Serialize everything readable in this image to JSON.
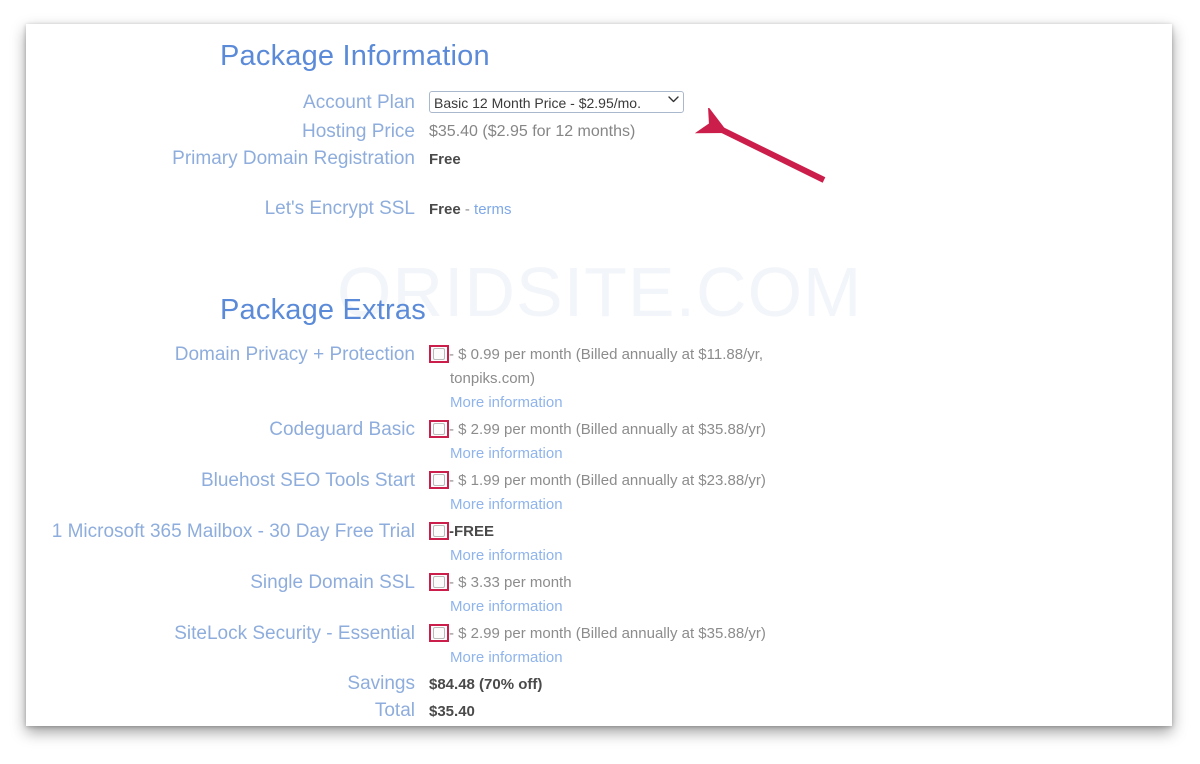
{
  "watermark": "ORIDSITE.COM",
  "sections": {
    "package_information": {
      "title": "Package Information",
      "rows": [
        {
          "label": "Account Plan",
          "type": "select",
          "value": "Basic 12 Month Price - $2.95/mo.",
          "options": [
            "Basic 12 Month Price - $2.95/mo."
          ]
        },
        {
          "label": "Hosting Price",
          "type": "text",
          "value": "$35.40  ($2.95 for 12 months)"
        },
        {
          "label": "Primary Domain Registration",
          "type": "bold",
          "value": "Free"
        },
        {
          "label": "Let's Encrypt SSL",
          "type": "bold_with_link",
          "value": "Free",
          "separator": " - ",
          "link_text": "terms"
        }
      ]
    },
    "package_extras": {
      "title": "Package Extras",
      "more_information_label": "More information",
      "rows": [
        {
          "label": "Domain Privacy + Protection",
          "type": "checkbox",
          "checked": false,
          "price_text": "- $ 0.99 per month (Billed annually at $11.88/yr,",
          "price_cont": "tonpiks.com)",
          "more_link": "More information"
        },
        {
          "label": "Codeguard Basic",
          "type": "checkbox",
          "checked": false,
          "price_text": "- $ 2.99 per month (Billed annually at $35.88/yr)",
          "price_cont": "",
          "more_link": "More information"
        },
        {
          "label": "Bluehost SEO Tools Start",
          "type": "checkbox",
          "checked": false,
          "price_text": "- $ 1.99 per month (Billed annually at $23.88/yr)",
          "price_cont": "",
          "more_link": "More information"
        },
        {
          "label": "1 Microsoft 365 Mailbox - 30 Day Free Trial",
          "type": "checkbox_bold",
          "checked": false,
          "price_text": "-FREE",
          "price_cont": "",
          "more_link": "More information"
        },
        {
          "label": "Single Domain SSL",
          "type": "checkbox",
          "checked": false,
          "price_text": "- $ 3.33 per month",
          "price_cont": "",
          "more_link": "More information"
        },
        {
          "label": "SiteLock Security - Essential",
          "type": "checkbox",
          "checked": false,
          "price_text": "- $ 2.99 per month (Billed annually at $35.88/yr)",
          "price_cont": "",
          "more_link": "More information"
        },
        {
          "label": "Savings",
          "type": "bold",
          "value": "$84.48 (70% off)"
        },
        {
          "label": "Total",
          "type": "bold",
          "value": "$35.40"
        }
      ]
    }
  },
  "annotation": {
    "arrow_color": "#cc1e4a",
    "points_to": "Account Plan dropdown"
  },
  "colors": {
    "heading": "#5b8bd8",
    "label": "#8eaddc",
    "link": "#8fb4ec",
    "value": "#4a4a4a",
    "highlight": "#cc1e4a"
  }
}
